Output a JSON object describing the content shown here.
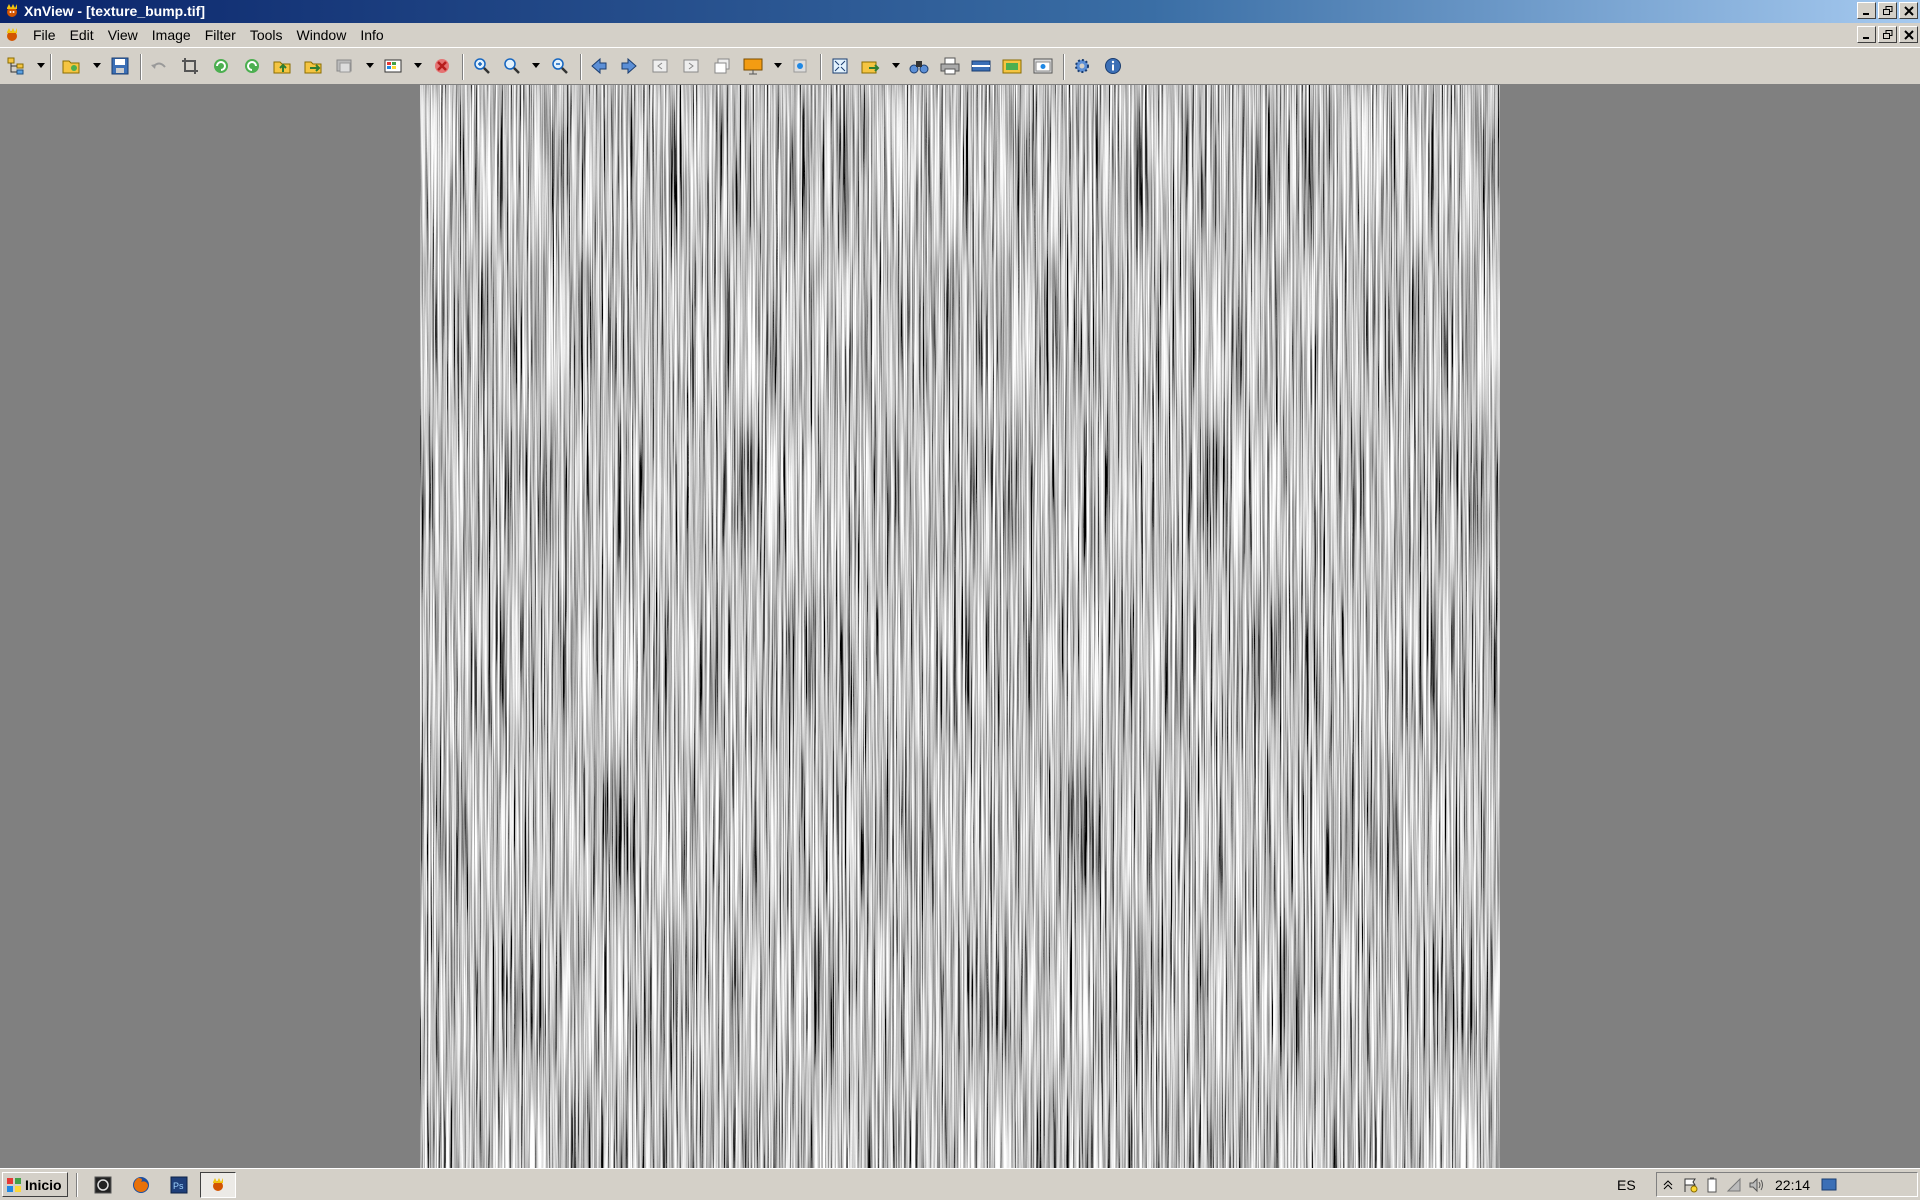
{
  "window": {
    "title": "XnView - [texture_bump.tif]"
  },
  "menu": {
    "items": [
      "File",
      "Edit",
      "View",
      "Image",
      "Filter",
      "Tools",
      "Window",
      "Info"
    ]
  },
  "taskbar": {
    "start_label": "Inicio",
    "language": "ES",
    "clock": "22:14"
  },
  "image": {
    "filename": "texture_bump.tif",
    "description_colors": {
      "dark": "#1a1a1a",
      "light": "#e8e8e8"
    }
  },
  "colors": {
    "title_start": "#0a246a",
    "title_end": "#a6caf0",
    "chrome": "#d4d0c8",
    "viewer_bg": "#808080"
  }
}
